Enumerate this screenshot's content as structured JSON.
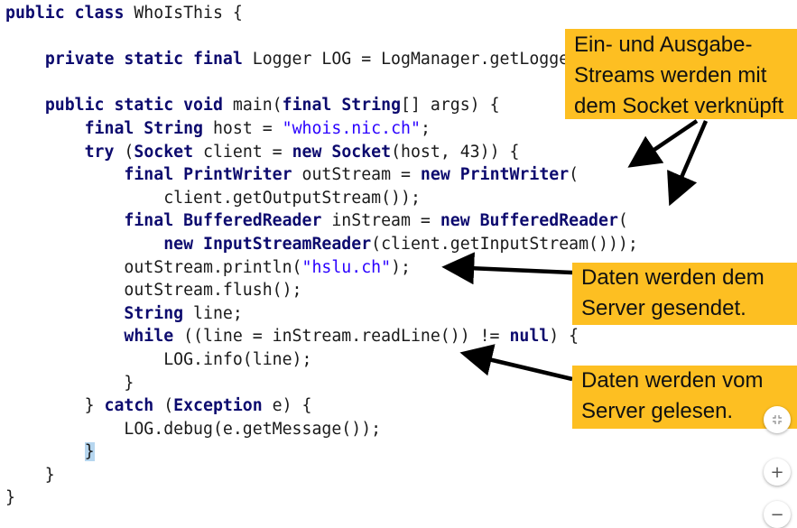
{
  "code": {
    "lines": [
      [
        {
          "t": "public class",
          "c": "k"
        },
        {
          "t": " WhoIsThis {",
          "c": "p"
        }
      ],
      [],
      [
        {
          "t": "    ",
          "c": "p"
        },
        {
          "t": "private static final",
          "c": "k"
        },
        {
          "t": " Logger LOG = LogManager.getLogger(",
          "c": "p"
        }
      ],
      [],
      [
        {
          "t": "    ",
          "c": "p"
        },
        {
          "t": "public static void",
          "c": "k"
        },
        {
          "t": " main(",
          "c": "p"
        },
        {
          "t": "final String",
          "c": "k"
        },
        {
          "t": "[] args) {",
          "c": "p"
        }
      ],
      [
        {
          "t": "        ",
          "c": "p"
        },
        {
          "t": "final String",
          "c": "k"
        },
        {
          "t": " host = ",
          "c": "p"
        },
        {
          "t": "\"whois.nic.ch\"",
          "c": "s"
        },
        {
          "t": ";",
          "c": "p"
        }
      ],
      [
        {
          "t": "        ",
          "c": "p"
        },
        {
          "t": "try",
          "c": "k"
        },
        {
          "t": " (",
          "c": "p"
        },
        {
          "t": "Socket",
          "c": "k"
        },
        {
          "t": " client = ",
          "c": "p"
        },
        {
          "t": "new Socket",
          "c": "k"
        },
        {
          "t": "(host, 43)) {",
          "c": "p"
        }
      ],
      [
        {
          "t": "            ",
          "c": "p"
        },
        {
          "t": "final PrintWriter",
          "c": "k"
        },
        {
          "t": " outStream = ",
          "c": "p"
        },
        {
          "t": "new PrintWriter",
          "c": "k"
        },
        {
          "t": "(",
          "c": "p"
        }
      ],
      [
        {
          "t": "                client.getOutputStream());",
          "c": "p"
        }
      ],
      [
        {
          "t": "            ",
          "c": "p"
        },
        {
          "t": "final BufferedReader",
          "c": "k"
        },
        {
          "t": " inStream = ",
          "c": "p"
        },
        {
          "t": "new BufferedReader",
          "c": "k"
        },
        {
          "t": "(",
          "c": "p"
        }
      ],
      [
        {
          "t": "                ",
          "c": "p"
        },
        {
          "t": "new InputStreamReader",
          "c": "k"
        },
        {
          "t": "(client.getInputStream()));",
          "c": "p"
        }
      ],
      [
        {
          "t": "            outStream.println(",
          "c": "p"
        },
        {
          "t": "\"hslu.ch\"",
          "c": "s"
        },
        {
          "t": ");",
          "c": "p"
        }
      ],
      [
        {
          "t": "            outStream.flush();",
          "c": "p"
        }
      ],
      [
        {
          "t": "            ",
          "c": "p"
        },
        {
          "t": "String",
          "c": "k"
        },
        {
          "t": " line;",
          "c": "p"
        }
      ],
      [
        {
          "t": "            ",
          "c": "p"
        },
        {
          "t": "while",
          "c": "k"
        },
        {
          "t": " ((line = inStream.readLine()) != ",
          "c": "p"
        },
        {
          "t": "null",
          "c": "k"
        },
        {
          "t": ") {",
          "c": "p"
        }
      ],
      [
        {
          "t": "                LOG.info(line);",
          "c": "p"
        }
      ],
      [
        {
          "t": "            }",
          "c": "p"
        }
      ],
      [
        {
          "t": "        } ",
          "c": "p"
        },
        {
          "t": "catch",
          "c": "k"
        },
        {
          "t": " (",
          "c": "p"
        },
        {
          "t": "Exception",
          "c": "k"
        },
        {
          "t": " e) {",
          "c": "p"
        }
      ],
      [
        {
          "t": "            LOG.debug(e.getMessage());",
          "c": "p"
        }
      ],
      [
        {
          "t": "        ",
          "c": "p"
        },
        {
          "t": "}",
          "c": "sel"
        }
      ],
      [
        {
          "t": "    }",
          "c": "p"
        }
      ],
      [
        {
          "t": "}",
          "c": "p"
        }
      ]
    ]
  },
  "callouts": [
    {
      "lines": [
        "Ein- und Ausgabe-",
        "Streams werden mit",
        "dem Socket verknüpft"
      ]
    },
    {
      "lines": [
        "Daten werden dem",
        "Server gesendet."
      ]
    },
    {
      "lines": [
        "Daten werden vom",
        "Server gelesen."
      ]
    }
  ],
  "controls": {
    "fit_icon": "fit-to-screen-icon",
    "zoom_in_label": "+",
    "zoom_out_label": "−"
  },
  "colors": {
    "keyword": "#0c0a6e",
    "string": "#2a00ff",
    "callout_bg": "#fdbf22",
    "bracket_highlight": "#b6d6ef"
  }
}
